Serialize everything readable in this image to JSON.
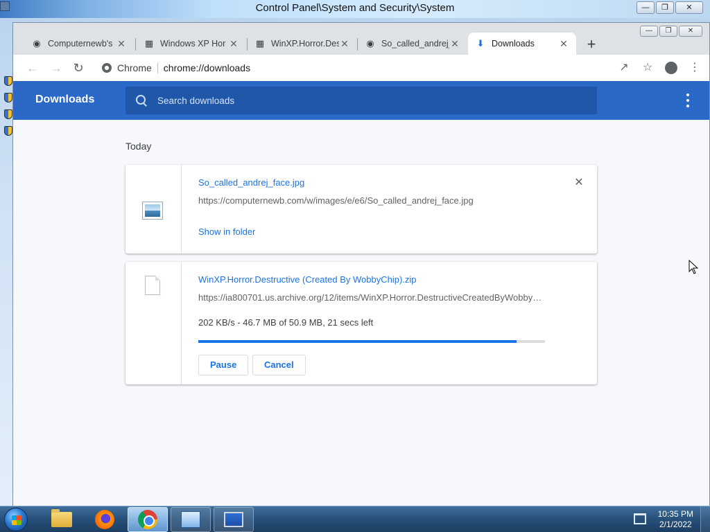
{
  "desktop": {
    "window_title": "Control Panel\\System and Security\\System"
  },
  "browser": {
    "tabs": [
      {
        "title": "Computernewb's",
        "icon": "wiki-icon",
        "active": false
      },
      {
        "title": "Windows XP Hor",
        "icon": "archive-icon",
        "active": false
      },
      {
        "title": "WinXP.Horror.Des",
        "icon": "archive-icon",
        "active": false
      },
      {
        "title": "So_called_andrej_",
        "icon": "wiki-icon",
        "active": false
      },
      {
        "title": "Downloads",
        "icon": "download-icon",
        "active": true
      }
    ],
    "omnibox": {
      "scheme_label": "Chrome",
      "url": "chrome://downloads"
    }
  },
  "downloads_page": {
    "title": "Downloads",
    "search_placeholder": "Search downloads",
    "section_date": "Today",
    "items": [
      {
        "file_name": "So_called_andrej_face.jpg",
        "url": "https://computernewb.com/w/images/e/e6/So_called_andrej_face.jpg",
        "link_label": "Show in folder",
        "icon": "image-file-icon"
      },
      {
        "file_name": "WinXP.Horror.Destructive (Created By WobbyChip).zip",
        "url": "https://ia800701.us.archive.org/12/items/WinXP.Horror.DestructiveCreatedByWobby…",
        "status": "202 KB/s - 46.7 MB of 50.9 MB, 21 secs left",
        "progress_percent": 91.7,
        "pause_label": "Pause",
        "cancel_label": "Cancel",
        "icon": "generic-file-icon"
      }
    ]
  },
  "taskbar": {
    "time": "10:35 PM",
    "date": "2/1/2022"
  },
  "colors": {
    "chrome_blue_header": "#2b69c8",
    "link_blue": "#1a73e8",
    "page_bg": "#f6f8fb"
  }
}
